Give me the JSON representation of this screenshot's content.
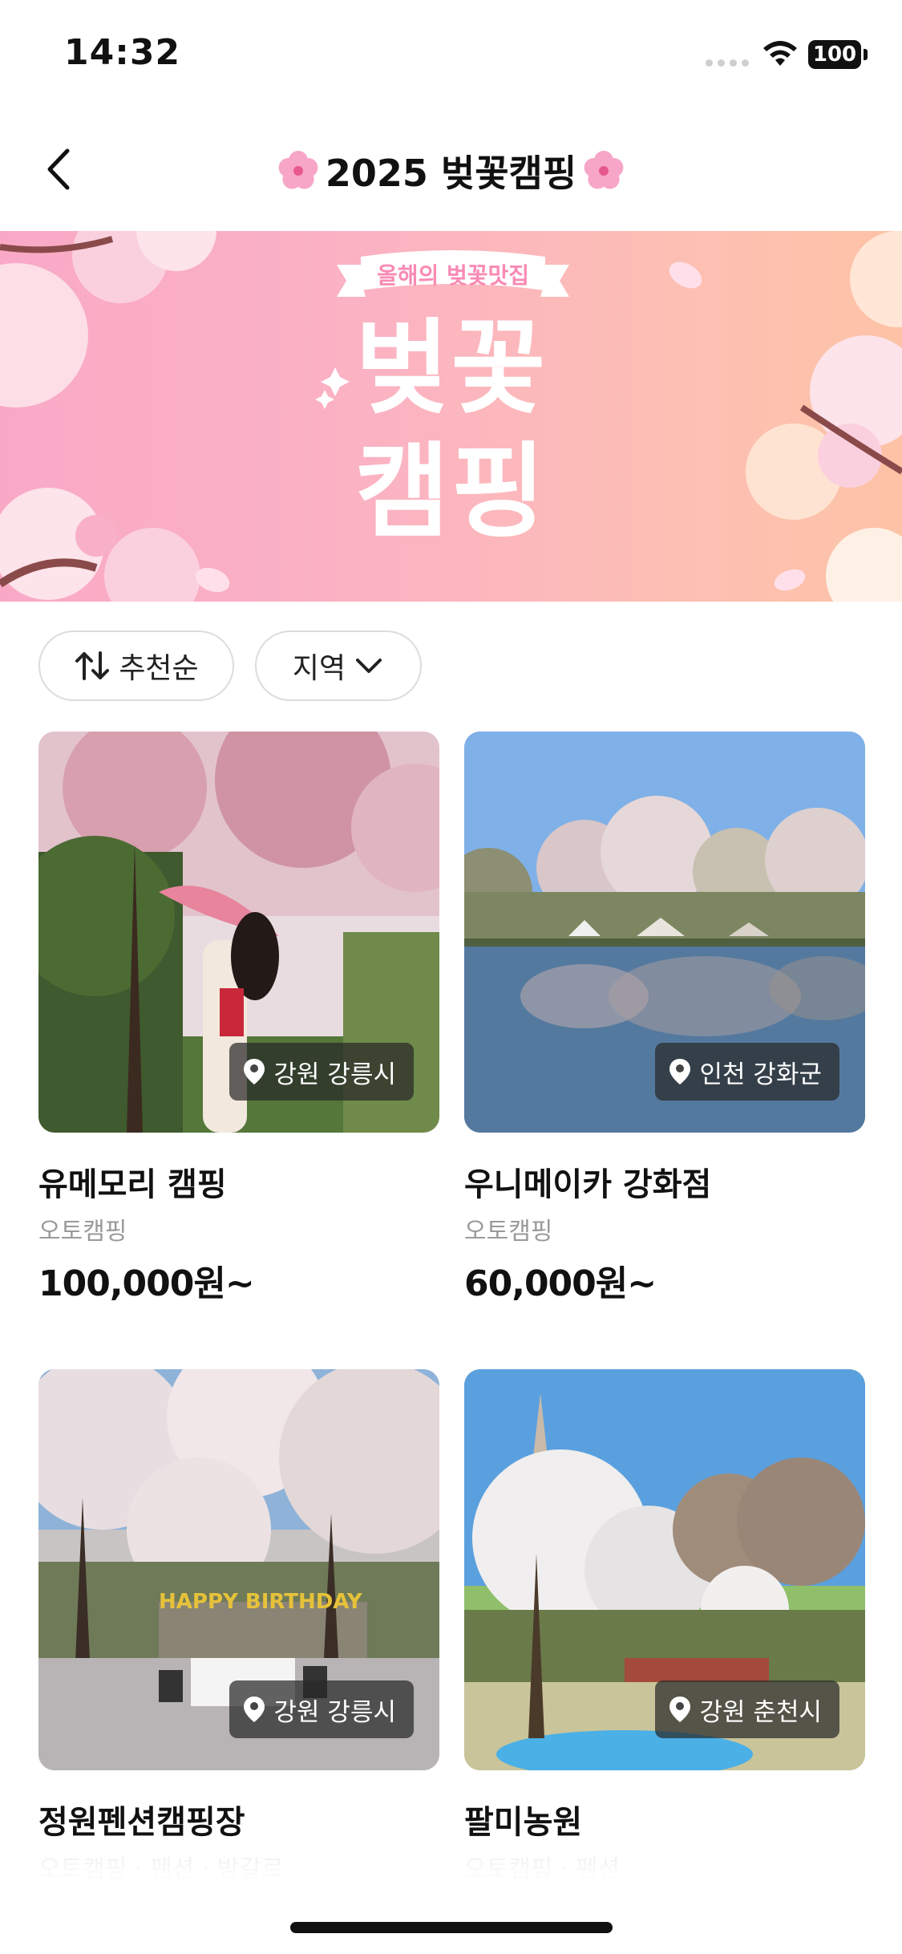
{
  "status_bar": {
    "time": "14:32",
    "battery": "100"
  },
  "header": {
    "title": "2025 벚꽃캠핑"
  },
  "banner": {
    "ribbon": "올해의 벚꽃맛집",
    "line1": "벚꽃",
    "line2": "캠핑"
  },
  "filters": {
    "sort_label": "추천순",
    "region_label": "지역"
  },
  "cards": [
    {
      "location": "강원 강릉시",
      "name": "유메모리 캠핑",
      "type": "오토캠핑",
      "price": "100,000원~"
    },
    {
      "location": "인천 강화군",
      "name": "우니메이카 강화점",
      "type": "오토캠핑",
      "price": "60,000원~"
    },
    {
      "location": "강원 강릉시",
      "name": "정원펜션캠핑장",
      "type": "오토캠핑 · 펜션 · 방갈로"
    },
    {
      "location": "강원 춘천시",
      "name": "팔미농원",
      "type": "오토캠핑 · 펜션"
    }
  ],
  "colors": {
    "banner_start": "#f9a9c6",
    "banner_end": "#fdc3a6",
    "accent_pink": "#f98ab3"
  }
}
